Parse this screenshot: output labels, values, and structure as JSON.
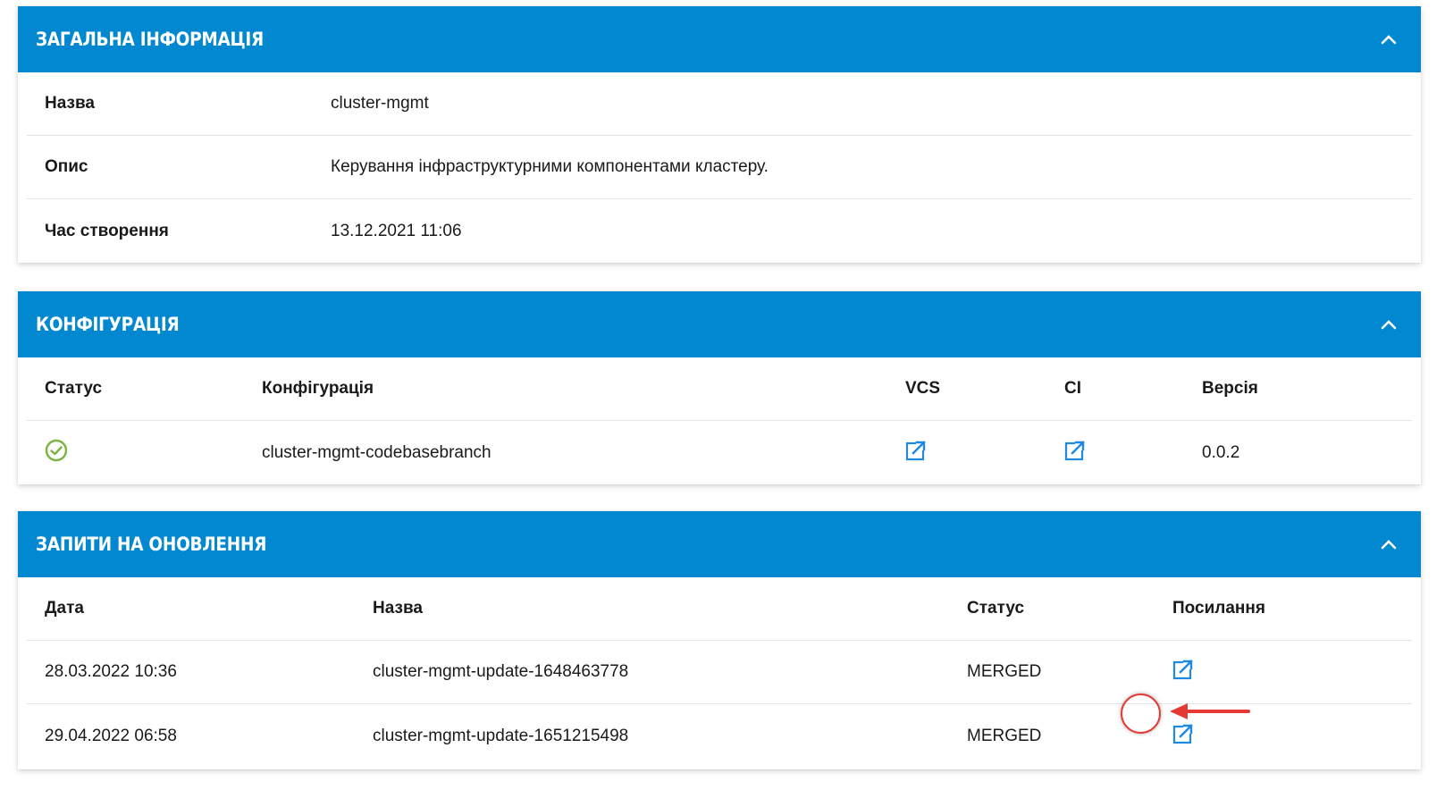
{
  "general": {
    "title": "ЗАГАЛЬНА ІНФОРМАЦІЯ",
    "rows": [
      {
        "label": "Назва",
        "value": "cluster-mgmt"
      },
      {
        "label": "Опис",
        "value": "Керування інфраструктурними компонентами кластеру."
      },
      {
        "label": "Час створення",
        "value": "13.12.2021 11:06"
      }
    ]
  },
  "configuration": {
    "title": "КОНФІГУРАЦІЯ",
    "columns": [
      "Статус",
      "Конфігурація",
      "VCS",
      "CI",
      "Версія"
    ],
    "rows": [
      {
        "status_icon": "check-circle-icon",
        "status_color": "#7cb342",
        "name": "cluster-mgmt-codebasebranch",
        "vcs_icon": "external-link-icon",
        "ci_icon": "external-link-icon",
        "version": "0.0.2"
      }
    ]
  },
  "update_requests": {
    "title": "ЗАПИТИ НА ОНОВЛЕННЯ",
    "columns": [
      "Дата",
      "Назва",
      "Статус",
      "Посилання"
    ],
    "rows": [
      {
        "date": "28.03.2022 10:36",
        "name": "cluster-mgmt-update-1648463778",
        "status": "MERGED",
        "link_icon": "external-link-icon"
      },
      {
        "date": "29.04.2022 06:58",
        "name": "cluster-mgmt-update-1651215498",
        "status": "MERGED",
        "link_icon": "external-link-icon"
      }
    ]
  },
  "colors": {
    "header_bg": "#0288d1",
    "link_icon": "#1e88e5",
    "success": "#7cb342",
    "highlight": "#e53935"
  }
}
